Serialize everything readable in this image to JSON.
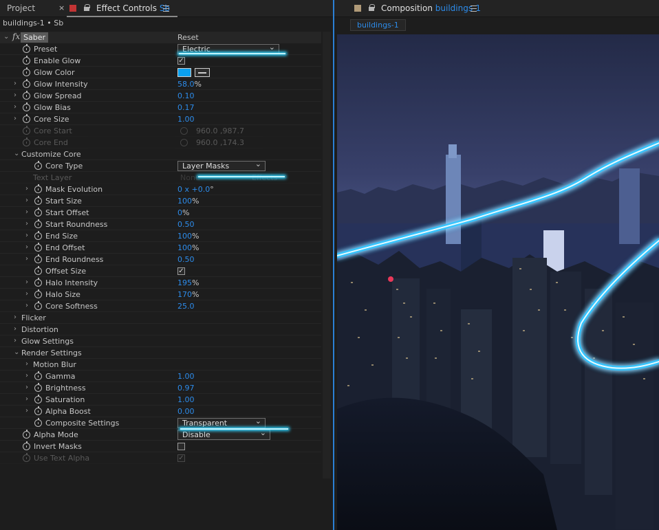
{
  "left_tabs": {
    "project": "Project",
    "effect_controls": "Effect Controls",
    "effect_controls_layer": "Sb"
  },
  "breadcrumb": "buildings-1 • Sb",
  "effect": {
    "name": "Saber",
    "reset": "Reset"
  },
  "rows": [
    {
      "label": "Preset",
      "type": "dropdown",
      "value": "Electric"
    },
    {
      "label": "Enable Glow",
      "type": "checkbox",
      "value": "✓"
    },
    {
      "label": "Glow Color",
      "type": "color",
      "value": "#0aa0ee"
    },
    {
      "label": "Glow Intensity",
      "value": "58.0",
      "unit": "%"
    },
    {
      "label": "Glow Spread",
      "value": "0.10"
    },
    {
      "label": "Glow Bias",
      "value": "0.17"
    },
    {
      "label": "Core Size",
      "value": "1.00"
    },
    {
      "label": "Core Start",
      "type": "point",
      "value": "960.0 ,987.7"
    },
    {
      "label": "Core End",
      "type": "point",
      "value": "960.0 ,174.3"
    },
    {
      "label": "Customize Core",
      "type": "group"
    },
    {
      "label": "Core Type",
      "type": "dropdown",
      "value": "Layer Masks"
    },
    {
      "label": "Text Layer",
      "type": "textlayer",
      "value": "None",
      "extra": "Effects"
    },
    {
      "label": "Mask Evolution",
      "value": "0 x +0.0",
      "unit": "°"
    },
    {
      "label": "Start Size",
      "value": "100",
      "unit": "%"
    },
    {
      "label": "Start Offset",
      "value": "0",
      "unit": "%"
    },
    {
      "label": "Start Roundness",
      "value": "0.50"
    },
    {
      "label": "End Size",
      "value": "100",
      "unit": "%"
    },
    {
      "label": "End Offset",
      "value": "100",
      "unit": "%"
    },
    {
      "label": "End Roundness",
      "value": "0.50"
    },
    {
      "label": "Offset Size",
      "type": "checkbox",
      "value": "✓"
    },
    {
      "label": "Halo Intensity",
      "value": "195",
      "unit": "%"
    },
    {
      "label": "Halo Size",
      "value": "170",
      "unit": "%"
    },
    {
      "label": "Core Softness",
      "value": "25.0"
    },
    {
      "label": "Flicker",
      "type": "group"
    },
    {
      "label": "Distortion",
      "type": "group"
    },
    {
      "label": "Glow Settings",
      "type": "group"
    },
    {
      "label": "Render Settings",
      "type": "group"
    },
    {
      "label": "Motion Blur",
      "type": "subgroup"
    },
    {
      "label": "Gamma",
      "value": "1.00"
    },
    {
      "label": "Brightness",
      "value": "0.97"
    },
    {
      "label": "Saturation",
      "value": "1.00"
    },
    {
      "label": "Alpha Boost",
      "value": "0.00"
    },
    {
      "label": "Composite Settings",
      "type": "dropdown",
      "value": "Transparent"
    },
    {
      "label": "Alpha Mode",
      "type": "dropdown",
      "value": "Disable"
    },
    {
      "label": "Invert Masks",
      "type": "checkbox",
      "value": ""
    },
    {
      "label": "Use Text Alpha",
      "type": "checkbox",
      "value": "✓"
    }
  ],
  "right_tabs": {
    "composition": "Composition",
    "composition_name": "buildings-1"
  },
  "comp_tab": "buildings-1",
  "colors": {
    "accent": "#2d8ceb",
    "glow": "#2fd3ff",
    "glow_color_swatch": "#0aa0ee"
  }
}
